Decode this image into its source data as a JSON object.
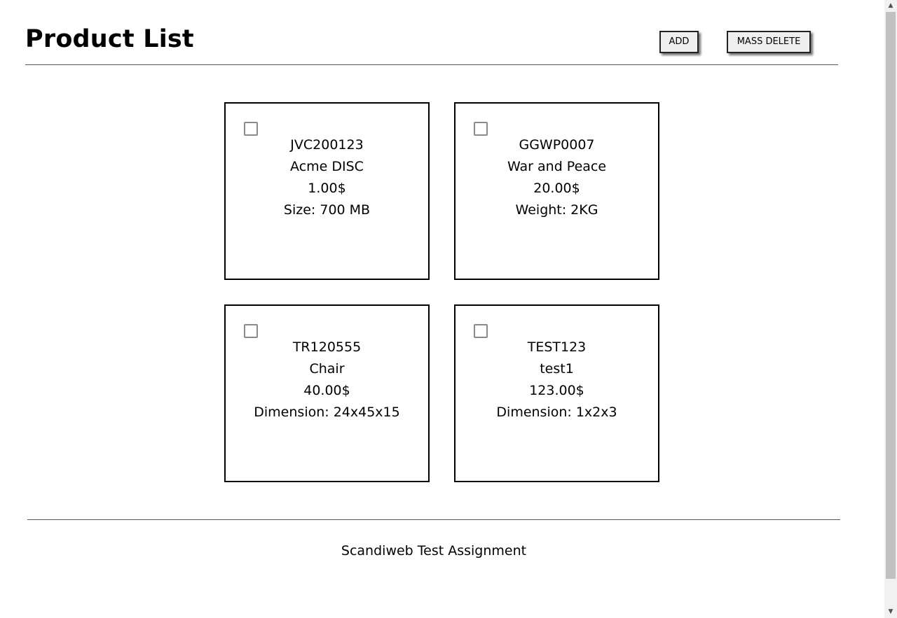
{
  "header": {
    "title": "Product List",
    "add_label": "ADD",
    "mass_delete_label": "MASS DELETE"
  },
  "products": [
    {
      "sku": "JVC200123",
      "name": "Acme DISC",
      "price": "1.00$",
      "attribute": "Size: 700 MB",
      "checked": false
    },
    {
      "sku": "GGWP0007",
      "name": "War and Peace",
      "price": "20.00$",
      "attribute": "Weight: 2KG",
      "checked": false
    },
    {
      "sku": "TR120555",
      "name": "Chair",
      "price": "40.00$",
      "attribute": "Dimension: 24x45x15",
      "checked": false
    },
    {
      "sku": "TEST123",
      "name": "test1",
      "price": "123.00$",
      "attribute": "Dimension: 1x2x3",
      "checked": false
    }
  ],
  "footer": {
    "text": "Scandiweb Test Assignment"
  },
  "icons": {
    "scroll_up": "chevron-up-icon",
    "scroll_down": "chevron-down-icon"
  }
}
